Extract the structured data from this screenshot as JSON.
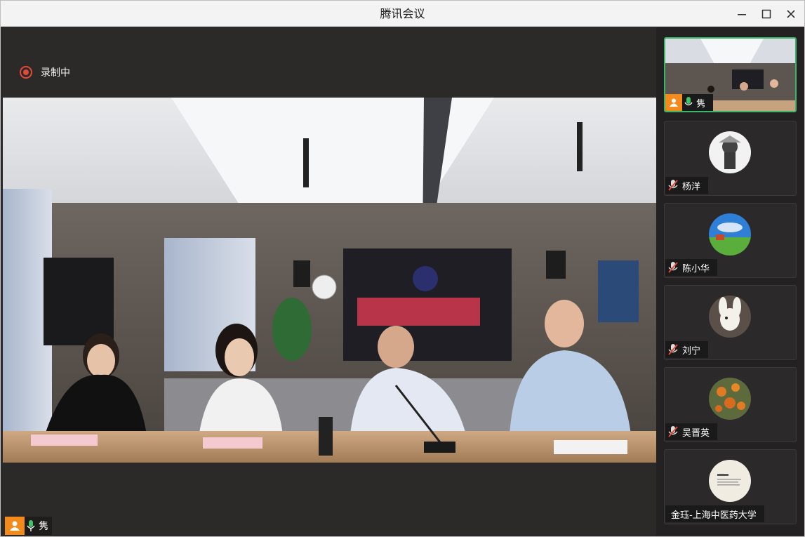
{
  "window": {
    "title": "腾讯会议"
  },
  "main": {
    "recording_label": "录制中",
    "speaker": {
      "name": "隽",
      "role_icon": "host-icon",
      "mic_icon": "mic-active-icon"
    }
  },
  "participants": [
    {
      "name": "隽",
      "mic": "active",
      "is_host": true
    },
    {
      "name": "杨洋",
      "mic": "muted"
    },
    {
      "name": "陈小华",
      "mic": "muted"
    },
    {
      "name": "刘宁",
      "mic": "muted"
    },
    {
      "name": "吴晋英",
      "mic": "muted"
    },
    {
      "name": "金珏-上海中医药大学",
      "mic": "none"
    }
  ],
  "colors": {
    "accent_green": "#39b86a",
    "host_orange": "#f28a1c",
    "record_red": "#e3483b"
  }
}
